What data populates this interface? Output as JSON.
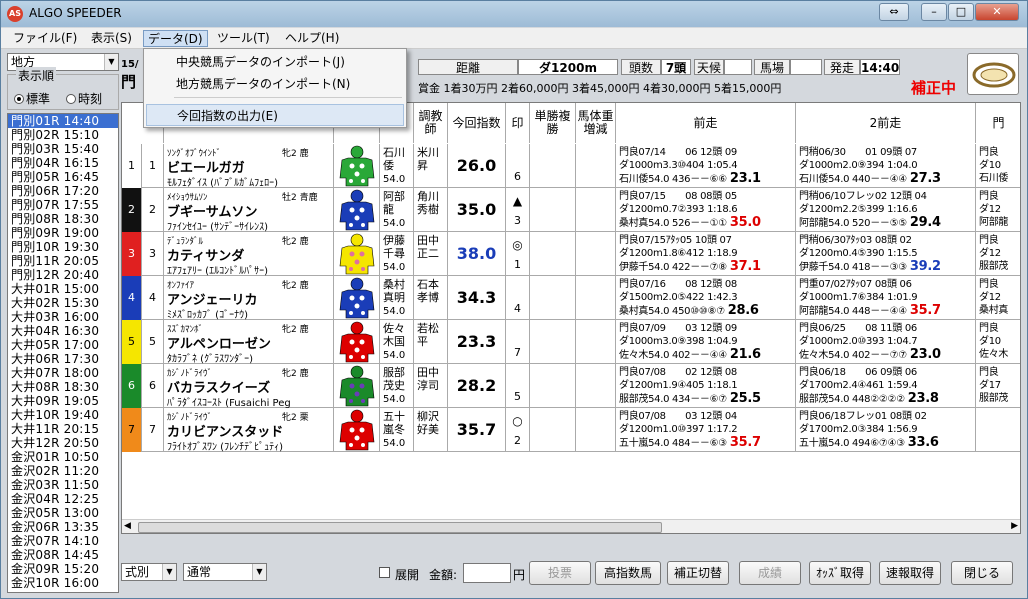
{
  "window": {
    "title": "ALGO SPEEDER",
    "icon_text": "AS"
  },
  "menu": [
    {
      "label": "ファイル(F)"
    },
    {
      "label": "表示(S)"
    },
    {
      "label": "データ(D)"
    },
    {
      "label": "ツール(T)"
    },
    {
      "label": "ヘルプ(H)"
    }
  ],
  "dropdown": {
    "items": [
      "中央競馬データのインポート(J)",
      "地方競馬データのインポート(N)",
      "今回指数の出力(E)"
    ]
  },
  "left": {
    "category": "地方",
    "order_label": "表示順",
    "radio": [
      "標準",
      "時刻"
    ],
    "races": [
      {
        "name": "門別01R",
        "time": "14:40"
      },
      {
        "name": "門別02R",
        "time": "15:10"
      },
      {
        "name": "門別03R",
        "time": "15:40"
      },
      {
        "name": "門別04R",
        "time": "16:15"
      },
      {
        "name": "門別05R",
        "time": "16:45"
      },
      {
        "name": "門別06R",
        "time": "17:20"
      },
      {
        "name": "門別07R",
        "time": "17:55"
      },
      {
        "name": "門別08R",
        "time": "18:30"
      },
      {
        "name": "門別09R",
        "time": "19:00"
      },
      {
        "name": "門別10R",
        "time": "19:30"
      },
      {
        "name": "門別11R",
        "time": "20:05"
      },
      {
        "name": "門別12R",
        "time": "20:40"
      },
      {
        "name": "大井01R",
        "time": "15:00"
      },
      {
        "name": "大井02R",
        "time": "15:30"
      },
      {
        "name": "大井03R",
        "time": "16:00"
      },
      {
        "name": "大井04R",
        "time": "16:30"
      },
      {
        "name": "大井05R",
        "time": "17:00"
      },
      {
        "name": "大井06R",
        "time": "17:30"
      },
      {
        "name": "大井07R",
        "time": "18:00"
      },
      {
        "name": "大井08R",
        "time": "18:30"
      },
      {
        "name": "大井09R",
        "time": "19:05"
      },
      {
        "name": "大井10R",
        "time": "19:40"
      },
      {
        "name": "大井11R",
        "time": "20:15"
      },
      {
        "name": "大井12R",
        "time": "20:50"
      },
      {
        "name": "金沢01R",
        "time": "10:50"
      },
      {
        "name": "金沢02R",
        "time": "11:20"
      },
      {
        "name": "金沢03R",
        "time": "11:50"
      },
      {
        "name": "金沢04R",
        "time": "12:25"
      },
      {
        "name": "金沢05R",
        "time": "13:00"
      },
      {
        "name": "金沢06R",
        "time": "13:35"
      },
      {
        "name": "金沢07R",
        "time": "14:10"
      },
      {
        "name": "金沢08R",
        "time": "14:45"
      },
      {
        "name": "金沢09R",
        "time": "15:20"
      },
      {
        "name": "金沢10R",
        "time": "16:00"
      }
    ]
  },
  "race_info": {
    "race_no": "15/",
    "course_short": "門",
    "distance_label": "距離",
    "distance": "ダ1200m",
    "count_label": "頭数",
    "count": "7頭",
    "weather_label": "天候",
    "weather": "",
    "track_label": "馬場",
    "track": "",
    "start_label": "発走",
    "start": "14:40",
    "prize": "賞金 1着30万円 2着60,000円 3着45,000円 4着30,000円 5着15,000円",
    "status": "補正中"
  },
  "columns": {
    "sire": "",
    "jockey": "",
    "trainer": "調教師",
    "idx": "今回指数",
    "mark": "印",
    "odds": "単勝複勝",
    "weight": "馬体重増減",
    "prev1": "前走",
    "prev2": "2前走",
    "prev3": "門"
  },
  "horses": [
    {
      "waku": "1",
      "uma": "1",
      "waku_color": "#ffffff",
      "waku_text": "#000",
      "sire": "ｿﾝｸﾞｵﾌﾞｳｲﾝﾄﾞ",
      "sex": "牝2 鹿",
      "name": "ビエールガガ",
      "pedigree": "ﾓﾙﾌｪﾀﾞｲｽ (ﾊﾞﾌﾞﾙｶﾞﾑﾌｪﾛｰ)",
      "jockey": "石川倭",
      "jw": "54.0",
      "trainer": "米川昇",
      "idx": "26.0",
      "idx_color": "#000",
      "mark": "",
      "rank": "6",
      "p1a": "門良07/14　　06 12頭 09",
      "p1b": "ダ1000m3.3⑩404 1:05.4",
      "p1c": "石川倭54.0 436－－⑥⑥",
      "p1v": "23.1",
      "p1c_col": "#000",
      "p2a": "門稍06/30　　01 09頭 07",
      "p2b": "ダ1000m2.0⑨394 1:04.0",
      "p2c": "石川倭54.0 440－－④④",
      "p2v": "27.3",
      "p2c_col": "#000",
      "p3": "門良\nダ10\n石川倭"
    },
    {
      "waku": "2",
      "uma": "2",
      "waku_color": "#111111",
      "waku_text": "#fff",
      "sire": "ﾒｲｼｮｳｻﾑｿﾝ",
      "sex": "牡2 青鹿",
      "name": "ブギーサムソン",
      "pedigree": "ﾌｧｲﾝｾｲﾕｰ (ｻﾝﾃﾞｰｻｲﾚﾝｽ)",
      "jockey": "阿部龍",
      "jw": "54.0",
      "trainer": "角川秀樹",
      "idx": "35.0",
      "idx_color": "#000",
      "mark": "▲",
      "rank": "3",
      "p1a": "門良07/15　　08 08頭 05",
      "p1b": "ダ1200m0.7②393 1:18.6",
      "p1c": "桑村真54.0 526－－①①",
      "p1v": "35.0",
      "p1c_col": "#d00",
      "p2a": "門稍06/10フレッ02 12頭 04",
      "p2b": "ダ1200m2.2⑤399 1:16.6",
      "p2c": "阿部龍54.0 520－－⑤⑤",
      "p2v": "29.4",
      "p2c_col": "#000",
      "p3": "門良\nダ12\n阿部龍"
    },
    {
      "waku": "3",
      "uma": "3",
      "waku_color": "#e02020",
      "waku_text": "#fff",
      "sire": "ﾃﾞｭﾗﾝﾀﾞﾙ",
      "sex": "牝2 鹿",
      "name": "カティサンダ",
      "pedigree": "ｴｱﾌｪｱﾘｰ (ｴﾙｺﾝﾄﾞﾙﾊﾟｻｰ)",
      "jockey": "伊藤千尋",
      "jw": "54.0",
      "trainer": "田中正二",
      "idx": "38.0",
      "idx_color": "#1a3db8",
      "mark": "◎",
      "rank": "1",
      "p1a": "門良07/15ｱﾀｯ05 10頭 07",
      "p1b": "ダ1200m1.8⑥412 1:18.9",
      "p1c": "伊藤千54.0 422－－⑦⑧",
      "p1v": "37.1",
      "p1c_col": "#d00",
      "p2a": "門稍06/30ｱﾀｯ03 08頭 02",
      "p2b": "ダ1200m0.4⑤390 1:15.5",
      "p2c": "伊藤千54.0 418－－③③",
      "p2v": "39.2",
      "p2c_col": "#1a3db8",
      "p3": "門良\nダ12\n服部茂"
    },
    {
      "waku": "4",
      "uma": "4",
      "waku_color": "#1a3db8",
      "waku_text": "#fff",
      "sire": "ｵﾝﾌｧｲｱ",
      "sex": "牝2 鹿",
      "name": "アンジェーリカ",
      "pedigree": "ﾐﾒｽﾞﾛｯｶﾌﾞ (ｺﾞｰﾅｳ)",
      "jockey": "桑村真明",
      "jw": "54.0",
      "trainer": "石本孝博",
      "idx": "34.3",
      "idx_color": "#000",
      "mark": "",
      "rank": "4",
      "p1a": "門良07/16　　08 12頭 08",
      "p1b": "ダ1500m2.0⑤422 1:42.3",
      "p1c": "桑村真54.0 450⑩⑩⑧⑦",
      "p1v": "28.6",
      "p1c_col": "#000",
      "p2a": "門重07/02ｱﾀｯ07 08頭 06",
      "p2b": "ダ1000m1.7⑥384 1:01.9",
      "p2c": "阿部龍54.0 448－－④④",
      "p2v": "35.7",
      "p2c_col": "#d00",
      "p3": "門良\nダ12\n桑村真"
    },
    {
      "waku": "5",
      "uma": "5",
      "waku_color": "#f5e600",
      "waku_text": "#000",
      "sire": "ｽｽﾞｶﾏﾝﾎﾞ",
      "sex": "牝2 鹿",
      "name": "アルペンローゼン",
      "pedigree": "ﾀｶﾗﾌﾞﾈ (ｸﾞﾗｽﾜﾝﾀﾞｰ)",
      "jockey": "佐々木国",
      "jw": "54.0",
      "trainer": "若松平",
      "idx": "23.3",
      "idx_color": "#000",
      "mark": "",
      "rank": "7",
      "p1a": "門良07/09　　03 12頭 09",
      "p1b": "ダ1000m3.0⑨398 1:04.9",
      "p1c": "佐々木54.0 402－－④④",
      "p1v": "21.6",
      "p1c_col": "#000",
      "p2a": "門良06/25　　08 11頭 06",
      "p2b": "ダ1000m2.0⑩393 1:04.7",
      "p2c": "佐々木54.0 402－－⑦⑦",
      "p2v": "23.0",
      "p2c_col": "#000",
      "p3": "門良\nダ10\n佐々木"
    },
    {
      "waku": "6",
      "uma": "6",
      "waku_color": "#1a8a2a",
      "waku_text": "#fff",
      "sire": "ｶｼﾞﾉﾄﾞﾗｲｳﾞ",
      "sex": "牝2 鹿",
      "name": "バカラスクイーズ",
      "pedigree": "ﾊﾟﾗﾀﾞｲｽｺｰｽﾄ (Fusaichi Peg",
      "jockey": "服部茂史",
      "jw": "54.0",
      "trainer": "田中淳司",
      "idx": "28.2",
      "idx_color": "#000",
      "mark": "",
      "rank": "5",
      "p1a": "門良07/08　　02 12頭 08",
      "p1b": "ダ1200m1.9④405 1:18.1",
      "p1c": "服部茂54.0 434－－⑥⑦",
      "p1v": "25.5",
      "p1c_col": "#000",
      "p2a": "門良06/18　　06 09頭 06",
      "p2b": "ダ1700m2.4④461 1:59.4",
      "p2c": "服部茂54.0 448②②②②",
      "p2v": "23.8",
      "p2c_col": "#000",
      "p3": "門良\nダ17\n服部茂"
    },
    {
      "waku": "7",
      "uma": "7",
      "waku_color": "#f08a1a",
      "waku_text": "#000",
      "sire": "ｶｼﾞﾉﾄﾞﾗｲｳﾞ",
      "sex": "牝2 栗",
      "name": "カリビアンスタッド",
      "pedigree": "ﾌﾗｲﾄｵﾌﾞｽﾜﾝ (ﾌﾚﾝﾁﾃﾞﾋﾟｭﾃｨ)",
      "jockey": "五十嵐冬",
      "jw": "54.0",
      "trainer": "柳沢好美",
      "idx": "35.7",
      "idx_color": "#000",
      "mark": "○",
      "rank": "2",
      "p1a": "門良07/08　　03 12頭 04",
      "p1b": "ダ1200m1.0⑩397 1:17.2",
      "p1c": "五十嵐54.0 484－－⑥③",
      "p1v": "35.7",
      "p1c_col": "#d00",
      "p2a": "門良06/18フレッ01 08頭 02",
      "p2b": "ダ1700m2.0③384 1:56.9",
      "p2c": "五十嵐54.0 494⑥⑦④③",
      "p2v": "33.6",
      "p2c_col": "#000",
      "p3": ""
    }
  ],
  "bottom": {
    "type_select": "式別",
    "mode_select": "通常",
    "expand_label": "展開",
    "amount_label": "金額:",
    "amount_unit": "円",
    "btn_bet": "投票",
    "btn_high": "高指数馬",
    "btn_switch": "補正切替",
    "btn_result": "成績",
    "btn_odds": "ｵｯｽﾞ取得",
    "btn_flash": "速報取得",
    "btn_close": "閉じる"
  }
}
